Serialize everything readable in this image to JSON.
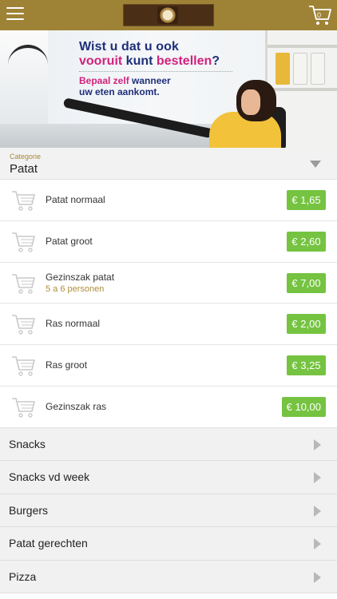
{
  "header": {
    "cart_count": "0"
  },
  "banner": {
    "line1": "Wist u dat u ook",
    "line2_a": "vooruit",
    "line2_b": " kunt ",
    "line2_c": "bestellen",
    "line2_d": "?",
    "line3_a": "Bepaal zelf",
    "line3_b": " wanneer",
    "line4": "uw eten aankomt."
  },
  "category": {
    "label": "Categorie",
    "value": "Patat"
  },
  "products": [
    {
      "name": "Patat normaal",
      "sub": "",
      "price": "€ 1,65"
    },
    {
      "name": "Patat groot",
      "sub": "",
      "price": "€ 2,60"
    },
    {
      "name": "Gezinszak patat",
      "sub": "5 a 6 personen",
      "price": "€ 7,00"
    },
    {
      "name": "Ras normaal",
      "sub": "",
      "price": "€ 2,00"
    },
    {
      "name": "Ras groot",
      "sub": "",
      "price": "€ 3,25"
    },
    {
      "name": "Gezinszak ras",
      "sub": "",
      "price": "€ 10,00"
    }
  ],
  "menu": [
    {
      "label": "Snacks"
    },
    {
      "label": "Snacks vd week"
    },
    {
      "label": "Burgers"
    },
    {
      "label": "Patat gerechten"
    },
    {
      "label": "Pizza"
    }
  ],
  "colors": {
    "topbar": "#9e8236",
    "price_badge": "#75c341",
    "accent_text": "#b08e3a",
    "banner_blue": "#1f2f7a",
    "banner_pink": "#d1227d"
  },
  "icons": {
    "menu": "hamburger-icon",
    "cart": "cart-icon",
    "category": "triangle-down-icon",
    "row": "triangle-right-icon"
  }
}
